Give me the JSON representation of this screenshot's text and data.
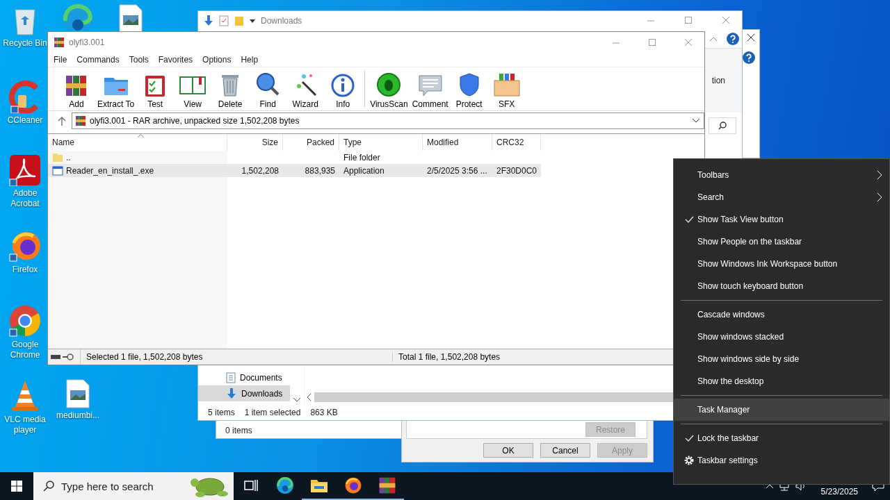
{
  "desktop_icons": [
    {
      "kind": "recycle",
      "label": "Recycle Bin"
    },
    {
      "kind": "edge"
    },
    {
      "kind": "image-file"
    },
    {
      "kind": "ccleaner",
      "label": "CCleaner"
    },
    {
      "kind": "acrobat",
      "label": "Adobe Acrobat"
    },
    {
      "kind": "firefox",
      "label": "Firefox"
    },
    {
      "kind": "chrome",
      "label": "Google Chrome"
    },
    {
      "kind": "vlc",
      "label": "VLC media player"
    },
    {
      "kind": "image-file",
      "label": "mediumbi..."
    }
  ],
  "explorer": {
    "title": "Downloads",
    "ribbon_text": "tion",
    "nav_items": [
      {
        "label": "Documents",
        "kind": "documents",
        "selected": false
      },
      {
        "label": "Downloads",
        "kind": "downloads",
        "selected": true
      }
    ],
    "status_count": "5 items",
    "status_selected": "1 item selected",
    "status_size": "863 KB"
  },
  "small_window": {
    "status": "0 items"
  },
  "dialog": {
    "inner_button": {
      "label": "Restore",
      "disabled": true
    },
    "buttons": [
      {
        "label": "OK",
        "disabled": false
      },
      {
        "label": "Cancel",
        "disabled": false
      },
      {
        "label": "Apply",
        "disabled": true
      }
    ]
  },
  "winrar": {
    "title": "olyfi3.001",
    "menu": [
      "File",
      "Commands",
      "Tools",
      "Favorites",
      "Options",
      "Help"
    ],
    "toolbar": [
      {
        "kind": "add",
        "label": "Add"
      },
      {
        "kind": "extract",
        "label": "Extract To"
      },
      {
        "kind": "test",
        "label": "Test"
      },
      {
        "kind": "view",
        "label": "View"
      },
      {
        "kind": "delete",
        "label": "Delete"
      },
      {
        "kind": "find",
        "label": "Find"
      },
      {
        "kind": "wizard",
        "label": "Wizard"
      },
      {
        "kind": "info",
        "label": "Info"
      },
      {
        "kind": "virusscan",
        "label": "VirusScan"
      },
      {
        "kind": "comment",
        "label": "Comment"
      },
      {
        "kind": "protect",
        "label": "Protect"
      },
      {
        "kind": "sfx",
        "label": "SFX"
      }
    ],
    "address": "olyfi3.001 - RAR archive, unpacked size 1,502,208 bytes",
    "columns": [
      {
        "label": "Name",
        "sorted": true
      },
      {
        "label": "Size",
        "sorted": false
      },
      {
        "label": "Packed",
        "sorted": false
      },
      {
        "label": "Type",
        "sorted": false
      },
      {
        "label": "Modified",
        "sorted": false
      },
      {
        "label": "CRC32",
        "sorted": false
      }
    ],
    "rows": [
      {
        "kind": "folder",
        "selected": false,
        "name": "..",
        "type": "File folder"
      },
      {
        "kind": "file",
        "selected": true,
        "name": "Reader_en_install_.exe",
        "size": "1,502,208",
        "packed": "883,935",
        "type": "Application",
        "modified": "2/5/2025 3:56 ...",
        "crc": "2F30D0C0"
      }
    ],
    "status_left": "Selected 1 file, 1,502,208 bytes",
    "status_right": "Total 1 file, 1,502,208 bytes"
  },
  "context_menu": {
    "groups": [
      {
        "items": [
          {
            "kind": "submenu",
            "label": "Toolbars",
            "checked": false,
            "selected": false
          },
          {
            "kind": "submenu",
            "label": "Search",
            "checked": false,
            "selected": false
          },
          {
            "kind": "option",
            "label": "Show Task View button",
            "checked": true,
            "selected": false
          },
          {
            "kind": "option",
            "label": "Show People on the taskbar",
            "checked": false,
            "selected": false
          },
          {
            "kind": "option",
            "label": "Show Windows Ink Workspace button",
            "checked": false,
            "selected": false
          },
          {
            "kind": "option",
            "label": "Show touch keyboard button",
            "checked": false,
            "selected": false
          }
        ]
      },
      {
        "items": [
          {
            "kind": "option",
            "label": "Cascade windows",
            "checked": false,
            "selected": false
          },
          {
            "kind": "option",
            "label": "Show windows stacked",
            "checked": false,
            "selected": false
          },
          {
            "kind": "option",
            "label": "Show windows side by side",
            "checked": false,
            "selected": false
          },
          {
            "kind": "option",
            "label": "Show the desktop",
            "checked": false,
            "selected": false
          }
        ]
      },
      {
        "items": [
          {
            "kind": "option",
            "label": "Task Manager",
            "checked": false,
            "selected": true
          }
        ]
      },
      {
        "items": [
          {
            "kind": "option",
            "label": "Lock the taskbar",
            "checked": true,
            "selected": false
          },
          {
            "kind": "settings",
            "label": "Taskbar settings",
            "checked": false,
            "selected": false
          }
        ]
      }
    ]
  },
  "taskbar": {
    "search_placeholder": "Type here to search",
    "apps": [
      {
        "kind": "taskview",
        "running": false
      },
      {
        "kind": "edge",
        "running": false
      },
      {
        "kind": "explorer",
        "running": true
      },
      {
        "kind": "firefox",
        "running": true
      },
      {
        "kind": "winrar",
        "running": true
      }
    ],
    "date": "5/23/2025"
  }
}
